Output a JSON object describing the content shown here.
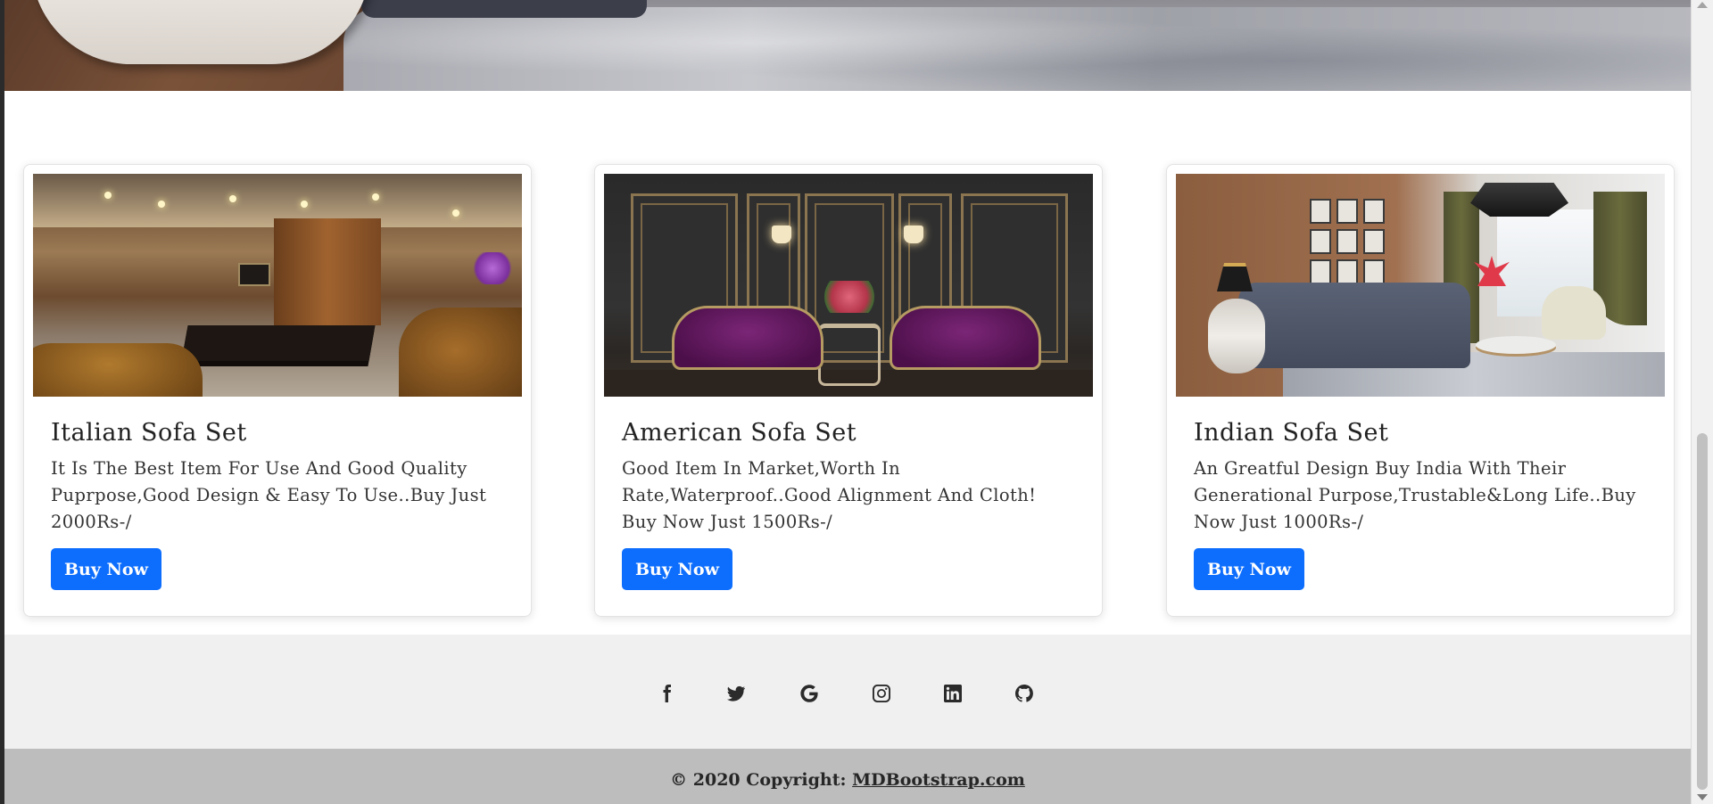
{
  "cards": [
    {
      "title": "Italian Sofa Set",
      "description": "It Is The Best Item For Use And Good Quality Puprpose,Good Design & Easy To Use..Buy Just 2000Rs-/",
      "button_label": "Buy Now"
    },
    {
      "title": "American Sofa Set",
      "description": "Good Item In Market,Worth In Rate,Waterproof..Good Alignment And Cloth! Buy Now Just 1500Rs-/",
      "button_label": "Buy Now"
    },
    {
      "title": "Indian Sofa Set",
      "description": "An Greatful Design Buy India With Their Generational Purpose,Trustable&Long Life..Buy Now Just 1000Rs-/",
      "button_label": "Buy Now"
    }
  ],
  "footer": {
    "social_icons": [
      "facebook-icon",
      "twitter-icon",
      "google-icon",
      "instagram-icon",
      "linkedin-icon",
      "github-icon"
    ],
    "copyright_prefix": "© 2020 Copyright:",
    "copyright_link": "MDBootstrap.com"
  },
  "colors": {
    "button_bg": "#0d6efd",
    "footer_social_bg": "#f0f0f0",
    "footer_copy_bg": "#bdbdbd"
  }
}
